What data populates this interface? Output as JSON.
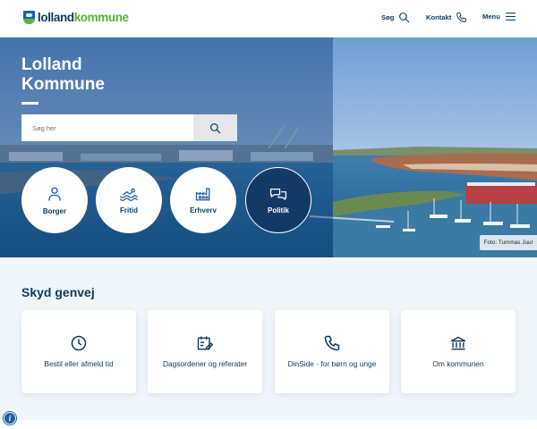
{
  "header": {
    "logo_text_a": "lolland",
    "logo_text_b": "kommune",
    "nav": {
      "search_label": "Søg",
      "contact_label": "Kontakt",
      "menu_label": "Menu"
    }
  },
  "hero": {
    "title_line1": "Lolland",
    "title_line2": "Kommune",
    "search": {
      "placeholder": "Søg her"
    },
    "categories": [
      {
        "label": "Borger",
        "icon": "person-icon"
      },
      {
        "label": "Fritid",
        "icon": "swimmer-icon"
      },
      {
        "label": "Erhverv",
        "icon": "factory-icon"
      },
      {
        "label": "Politik",
        "icon": "speech-bubbles-icon"
      }
    ],
    "photo_credit": "Foto: Tummas Juul"
  },
  "shortcuts": {
    "title": "Skyd genvej",
    "cards": [
      {
        "label": "Bestil eller afmeld tid",
        "icon": "clock-icon"
      },
      {
        "label": "Dagsordener og referater",
        "icon": "calendar-edit-icon"
      },
      {
        "label": "DinSide - for børn og unge",
        "icon": "phone-icon"
      },
      {
        "label": "Om kommunen",
        "icon": "town-hall-icon"
      }
    ]
  },
  "colors": {
    "primary_text": "#0b3a5c",
    "brand_green": "#5aae3c",
    "brand_blue": "#1a63b0",
    "section_bg": "#f1f6fa"
  },
  "info_button": "i"
}
